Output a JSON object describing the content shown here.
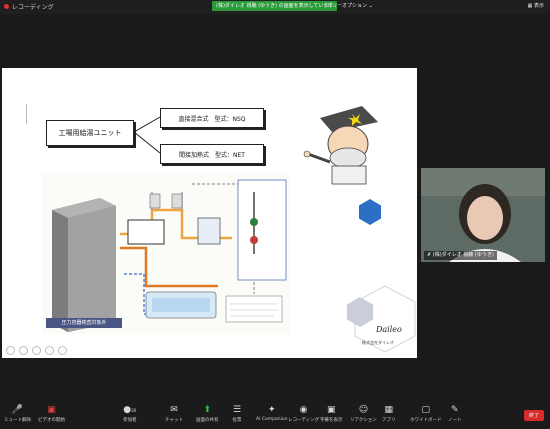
{
  "topbar": {
    "recording_label": "レコーディング",
    "share_banner": "(株)ダイレオ 視聴 (ゆうき) の画面を表示しています",
    "view_options": "ビューオプション",
    "view_button": "表示"
  },
  "slide": {
    "main_label": "工場用給湯ユニット",
    "type1": "直接混合式　型式：NSQ",
    "type2": "間接加熱式　型式：NET",
    "bottom_label": "圧力容器検査対象外",
    "logo_text": "Daileo",
    "logo_sub": "株式会社ダイレオ"
  },
  "video": {
    "participant_name": "(株)ダイレオ 視聴 (ゆうき)"
  },
  "toolbar": {
    "items": [
      {
        "label": "ミュート解除",
        "icon": "mic-muted-icon"
      },
      {
        "label": "ビデオの開始",
        "icon": "video-off-icon"
      },
      {
        "label": "参加者",
        "icon": "participants-icon",
        "count": "30"
      },
      {
        "label": "チャット",
        "icon": "chat-icon"
      },
      {
        "label": "画面の共有",
        "icon": "share-screen-icon"
      },
      {
        "label": "投票",
        "icon": "poll-icon"
      },
      {
        "label": "AI Companion",
        "icon": "ai-companion-icon"
      },
      {
        "label": "レコーディング",
        "icon": "record-icon"
      },
      {
        "label": "字幕を表示",
        "icon": "captions-icon"
      },
      {
        "label": "リアクション",
        "icon": "reaction-icon"
      },
      {
        "label": "アプリ",
        "icon": "apps-icon"
      },
      {
        "label": "ホワイトボード",
        "icon": "whiteboard-icon"
      },
      {
        "label": "ノート",
        "icon": "notes-icon"
      }
    ],
    "end_label": "終了"
  },
  "colors": {
    "share_green": "#2a9a3a",
    "end_red": "#d92c2c",
    "slide_label_blue": "#4a5583",
    "hex_blue": "#2d6fc4"
  }
}
